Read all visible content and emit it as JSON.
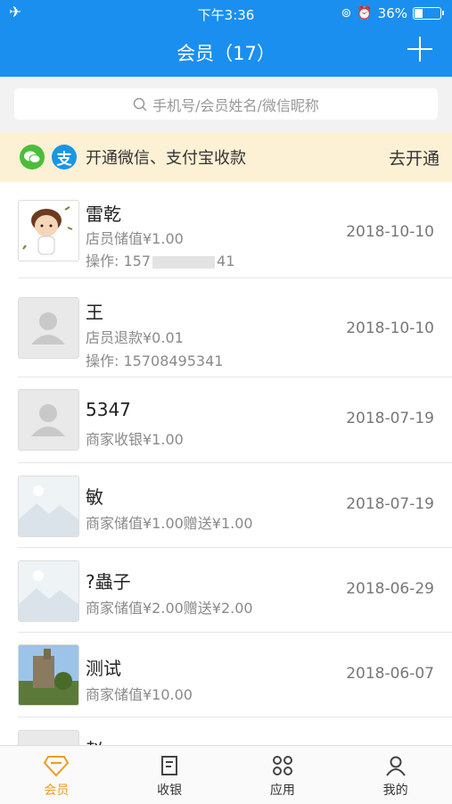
{
  "status": {
    "time": "下午3:36",
    "battery": "36%"
  },
  "nav": {
    "title": "会员（17）"
  },
  "search": {
    "placeholder": "手机号/会员姓名/微信昵称"
  },
  "banner": {
    "text": "开通微信、支付宝收款",
    "action": "去开通",
    "alipay_glyph": "支"
  },
  "members": [
    {
      "name": "雷乾",
      "line1": "店员储值¥1.00",
      "line2": "操作: 157",
      "line2_tail": "41",
      "date": "2018-10-10",
      "avatar": "cartoon"
    },
    {
      "name": "王",
      "line1": "店员退款¥0.01",
      "line2": "操作: 15708495341",
      "date": "2018-10-10",
      "avatar": "default"
    },
    {
      "name": "5347",
      "line1": "商家收银¥1.00",
      "date": "2018-07-19",
      "avatar": "default"
    },
    {
      "name": "敏",
      "line1": "商家储值¥1.00赠送¥1.00",
      "date": "2018-07-19",
      "avatar": "placeholder"
    },
    {
      "name": "?蟲子",
      "line1": "商家储值¥2.00赠送¥2.00",
      "date": "2018-06-29",
      "avatar": "placeholder"
    },
    {
      "name": "测试",
      "line1": "商家储值¥10.00",
      "date": "2018-06-07",
      "avatar": "photo"
    },
    {
      "name": "赵",
      "avatar": "default"
    }
  ],
  "tabs": [
    {
      "label": "会员",
      "active": true
    },
    {
      "label": "收银"
    },
    {
      "label": "应用"
    },
    {
      "label": "我的"
    }
  ],
  "colors": {
    "primary": "#1a8ff0",
    "active_tab": "#f29b1f",
    "banner_bg": "#fdf1d5"
  }
}
